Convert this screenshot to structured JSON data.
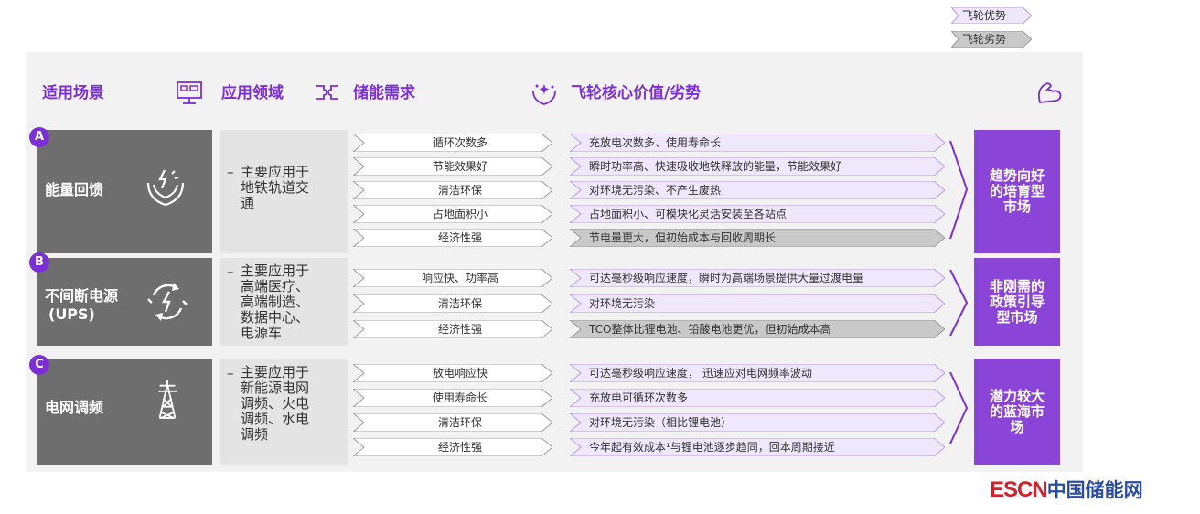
{
  "legend": [
    {
      "label": "飞轮优势",
      "color": "#efe7fb"
    },
    {
      "label": "飞轮劣势",
      "color": "#c9c9c9"
    }
  ],
  "headers": {
    "scenario": "适用场景",
    "field": "应用领域",
    "need": "储能需求",
    "value": "飞轮核心价值/劣势"
  },
  "colors": {
    "accent": "#7b2fd6",
    "outcome": "#8b44d8",
    "scenario_bg": "#6e6e6e",
    "advantage": "#efe7fb",
    "disadvantage": "#c9c9c9"
  },
  "rows": [
    {
      "letter": "A",
      "scenario": "能量回馈",
      "icon": "hands-energy-icon",
      "field_dash": "–",
      "field": "主要应用于\n地铁轨道交\n通",
      "needs": [
        "循环次数多",
        "节能效果好",
        "清洁环保",
        "占地面积小",
        "经济性强"
      ],
      "values": [
        {
          "text": "充放电次数多、使用寿命长",
          "type": "advantage"
        },
        {
          "text": "瞬时功率高、快速吸收地铁释放的能量，节能效果好",
          "type": "advantage"
        },
        {
          "text": "对环境无污染、不产生废热",
          "type": "advantage"
        },
        {
          "text": "占地面积小、可模块化灵活安装至各站点",
          "type": "advantage"
        },
        {
          "text": "节电量更大，但初始成本与回收周期长",
          "type": "disadvantage"
        }
      ],
      "outcome": "趋势向好的培育型市场"
    },
    {
      "letter": "B",
      "scenario": "不间断电源",
      "scenario_sub": "(UPS)",
      "icon": "circular-power-icon",
      "field_dash": "–",
      "field": "主要应用于\n高端医疗、\n高端制造、\n数据中心、\n电源车",
      "needs": [
        "响应快、功率高",
        "清洁环保",
        "经济性强"
      ],
      "values": [
        {
          "text": "可达毫秒级响应速度，瞬时为高端场景提供大量过渡电量",
          "type": "advantage"
        },
        {
          "text": "对环境无污染",
          "type": "advantage"
        },
        {
          "text": "TCO整体比锂电池、铅酸电池更优，但初始成本高",
          "type": "disadvantage"
        }
      ],
      "outcome": "非刚需的政策引导型市场"
    },
    {
      "letter": "C",
      "scenario": "电网调频",
      "icon": "transmission-tower-icon",
      "field_dash": "–",
      "field": "主要应用于\n新能源电网\n调频、火电\n调频、水电\n调频",
      "needs": [
        "放电响应快",
        "使用寿命长",
        "清洁环保",
        "经济性强"
      ],
      "values": [
        {
          "text": "可达毫秒级响应速度， 迅速应对电网频率波动",
          "type": "advantage"
        },
        {
          "text": "充放电可循环次数多",
          "type": "advantage"
        },
        {
          "text": "对环境无污染（相比锂电池）",
          "type": "advantage"
        },
        {
          "text": "今年起有效成本¹与锂电池逐步趋同，回本周期接近",
          "type": "advantage"
        }
      ],
      "outcome": "潜力较大的蓝海市场"
    }
  ],
  "brand": {
    "en": "ESCN",
    "cn": "中国储能网"
  }
}
